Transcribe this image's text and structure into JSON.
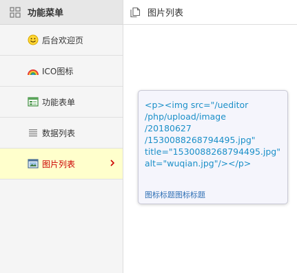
{
  "sidebar": {
    "title": "功能菜单",
    "header_icon": "grid-icon",
    "items": [
      {
        "label": "后台欢迎页",
        "icon": "smiley-icon",
        "active": false
      },
      {
        "label": "ICO图标",
        "icon": "rainbow-icon",
        "active": false
      },
      {
        "label": "功能表单",
        "icon": "form-icon",
        "active": false
      },
      {
        "label": "数据列表",
        "icon": "list-icon",
        "active": false
      },
      {
        "label": "图片列表",
        "icon": "image-icon",
        "active": true
      }
    ]
  },
  "topbar": {
    "title": "图片列表",
    "icon": "copy-icon"
  },
  "tooltip": {
    "code_lines": [
      "<p><img src=\"/ueditor",
      "/php/upload/image",
      "/20180627",
      "/1530088268794495.jpg\"",
      "title=\"1530088268794495.jpg\"",
      "alt=\"wuqian.jpg\"/></p>"
    ],
    "caption": "图标标题图标标题"
  },
  "colors": {
    "active_bg": "#ffffcc",
    "active_text": "#cc0000",
    "code_text": "#1a8fc8",
    "caption_text": "#2e6fb5"
  }
}
